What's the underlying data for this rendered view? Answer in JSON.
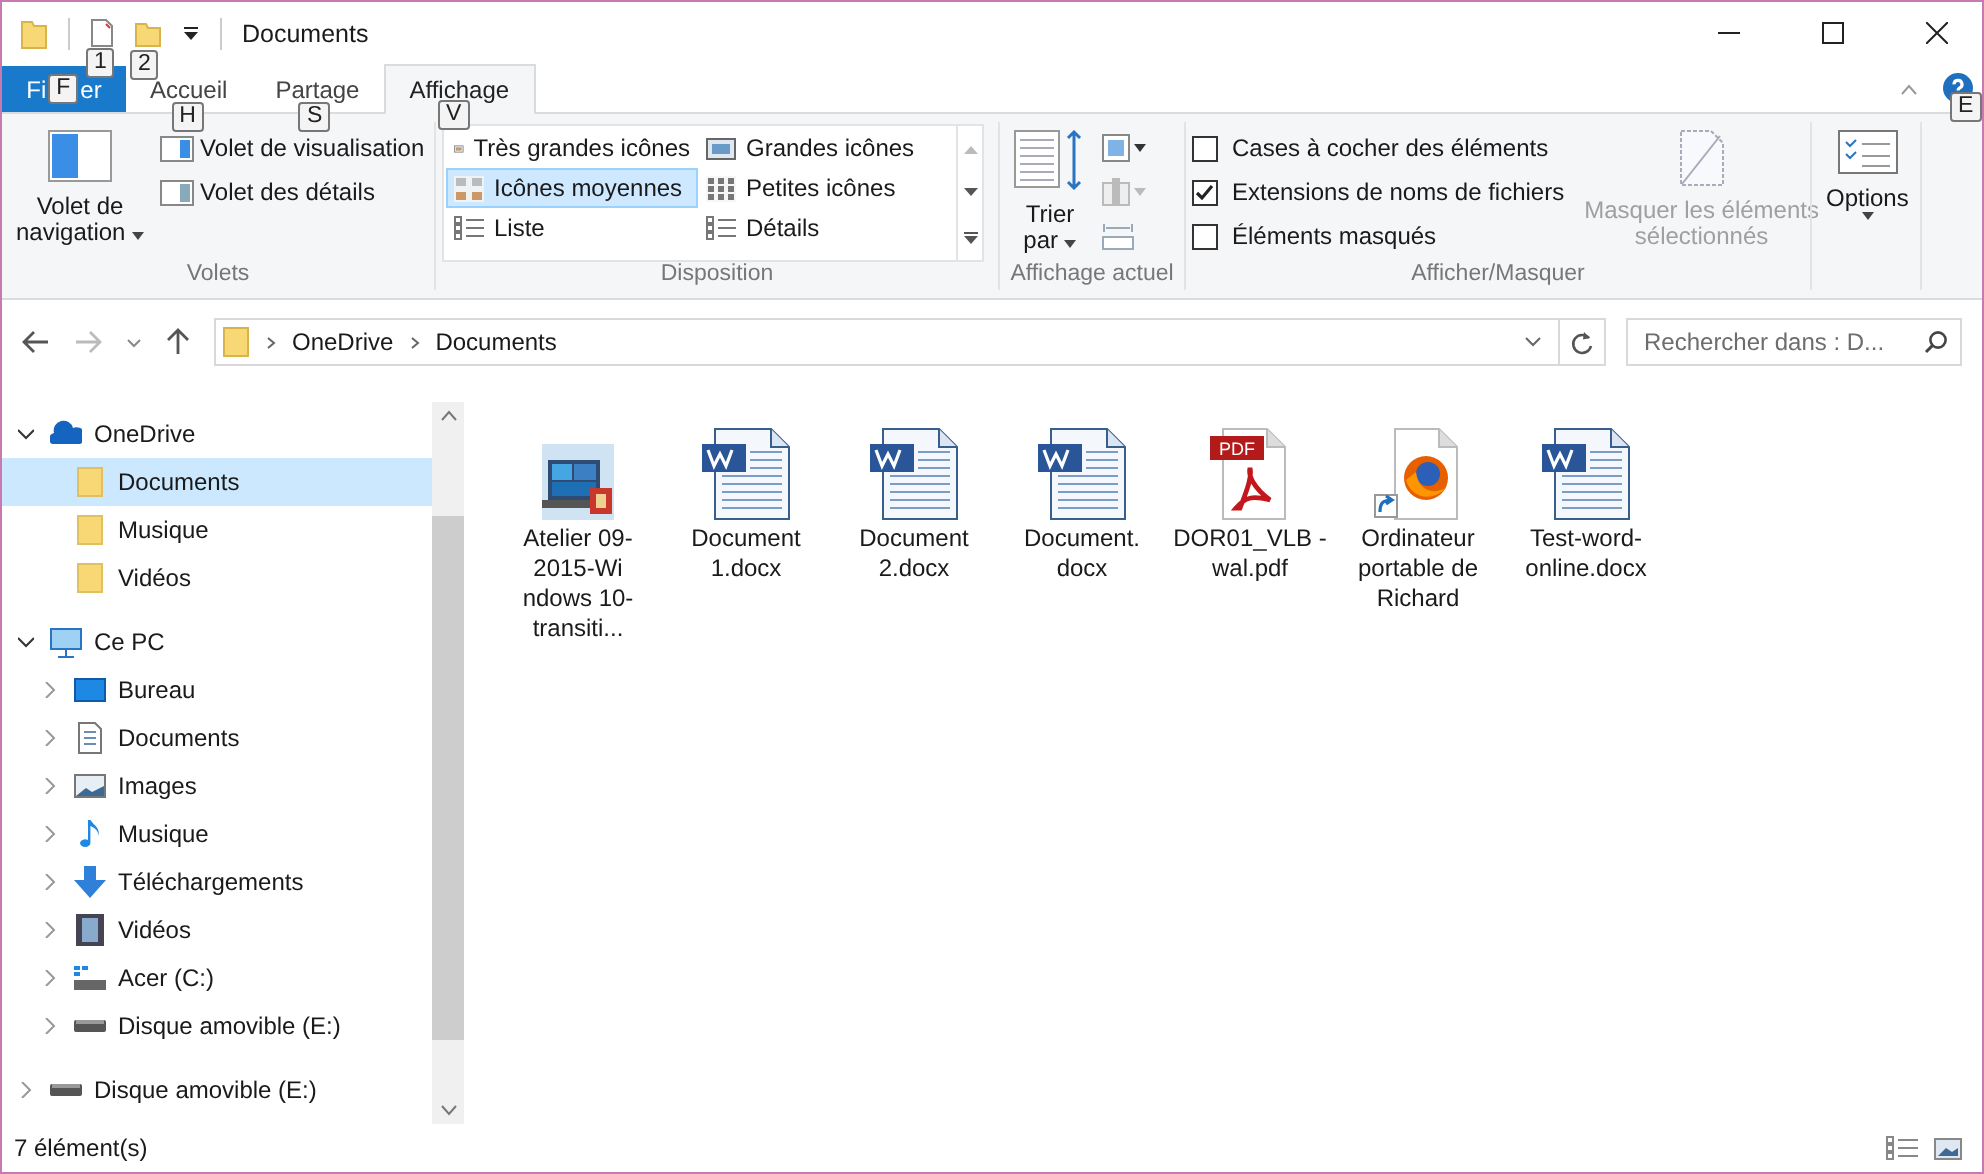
{
  "window": {
    "title": "Documents",
    "quick_access_keytips": [
      "1",
      "2"
    ]
  },
  "ribbon": {
    "file_tab": {
      "label_parts": [
        "Fi",
        "er"
      ],
      "keytip": "F"
    },
    "tabs": [
      {
        "label": "Accueil",
        "keytip": "H",
        "selected": false
      },
      {
        "label": "Partage",
        "keytip": "S",
        "selected": false
      },
      {
        "label": "Affichage",
        "keytip": "V",
        "selected": true
      }
    ],
    "help_keytip": "E",
    "panes": {
      "nav_button": [
        "Volet de",
        "navigation"
      ],
      "items": [
        "Volet de visualisation",
        "Volet des détails"
      ],
      "label": "Volets"
    },
    "layout": {
      "options": [
        {
          "label": "Très grandes icônes",
          "selected": false
        },
        {
          "label": "Grandes icônes",
          "selected": false
        },
        {
          "label": "Icônes moyennes",
          "selected": true
        },
        {
          "label": "Petites icônes",
          "selected": false
        },
        {
          "label": "Liste",
          "selected": false
        },
        {
          "label": "Détails",
          "selected": false
        }
      ],
      "label": "Disposition"
    },
    "current_view": {
      "sort_button": [
        "Trier",
        "par"
      ],
      "label": "Affichage actuel"
    },
    "show_hide": {
      "checkboxes": [
        {
          "label": "Cases à cocher des éléments",
          "checked": false
        },
        {
          "label": "Extensions de noms de fichiers",
          "checked": true
        },
        {
          "label": "Éléments masqués",
          "checked": false
        }
      ],
      "hide_selected": {
        "label": [
          "Masquer les éléments",
          "sélectionnés"
        ],
        "disabled": true
      },
      "label": "Afficher/Masquer"
    },
    "options": {
      "label": "Options"
    }
  },
  "address_bar": {
    "crumbs": [
      "OneDrive",
      "Documents"
    ]
  },
  "search": {
    "placeholder": "Rechercher dans : D..."
  },
  "nav": {
    "items": [
      {
        "label": "OneDrive",
        "kind": "onedrive",
        "expanded": true,
        "selected": false,
        "children": [
          {
            "label": "Documents",
            "kind": "folder",
            "selected": true
          },
          {
            "label": "Musique",
            "kind": "folder",
            "selected": false
          },
          {
            "label": "Vidéos",
            "kind": "folder",
            "selected": false
          }
        ]
      },
      {
        "label": "Ce PC",
        "kind": "pc",
        "expanded": true,
        "selected": false,
        "children": [
          {
            "label": "Bureau",
            "kind": "desktop",
            "expanded": false,
            "selected": false
          },
          {
            "label": "Documents",
            "kind": "documents",
            "expanded": false,
            "selected": false
          },
          {
            "label": "Images",
            "kind": "images",
            "expanded": false,
            "selected": false
          },
          {
            "label": "Musique",
            "kind": "music",
            "expanded": false,
            "selected": false
          },
          {
            "label": "Téléchargements",
            "kind": "downloads",
            "expanded": false,
            "selected": false
          },
          {
            "label": "Vidéos",
            "kind": "videos",
            "expanded": false,
            "selected": false
          },
          {
            "label": "Acer (C:)",
            "kind": "systemdrive",
            "expanded": false,
            "selected": false
          },
          {
            "label": "Disque amovible (E:)",
            "kind": "drive",
            "expanded": false,
            "selected": false
          }
        ]
      },
      {
        "label": "Disque amovible (E:)",
        "kind": "drive",
        "expanded": false,
        "selected": false
      }
    ]
  },
  "files": [
    {
      "name": "Atelier 09-2015-Wi ndows 10-transiti...",
      "kind": "picture",
      "selected": false
    },
    {
      "name": "Document 1.docx",
      "kind": "word",
      "selected": false
    },
    {
      "name": "Document 2.docx",
      "kind": "word",
      "selected": false
    },
    {
      "name": "Document. docx",
      "kind": "word",
      "selected": false
    },
    {
      "name": "DOR01_VLB -wal.pdf",
      "kind": "pdf",
      "selected": false,
      "badge": "PDF"
    },
    {
      "name": "Ordinateur portable de Richard",
      "kind": "shortcut",
      "selected": false
    },
    {
      "name": "Test-word- online.docx",
      "kind": "word",
      "selected": false
    }
  ],
  "status_bar": {
    "count": "7 élément(s)"
  }
}
